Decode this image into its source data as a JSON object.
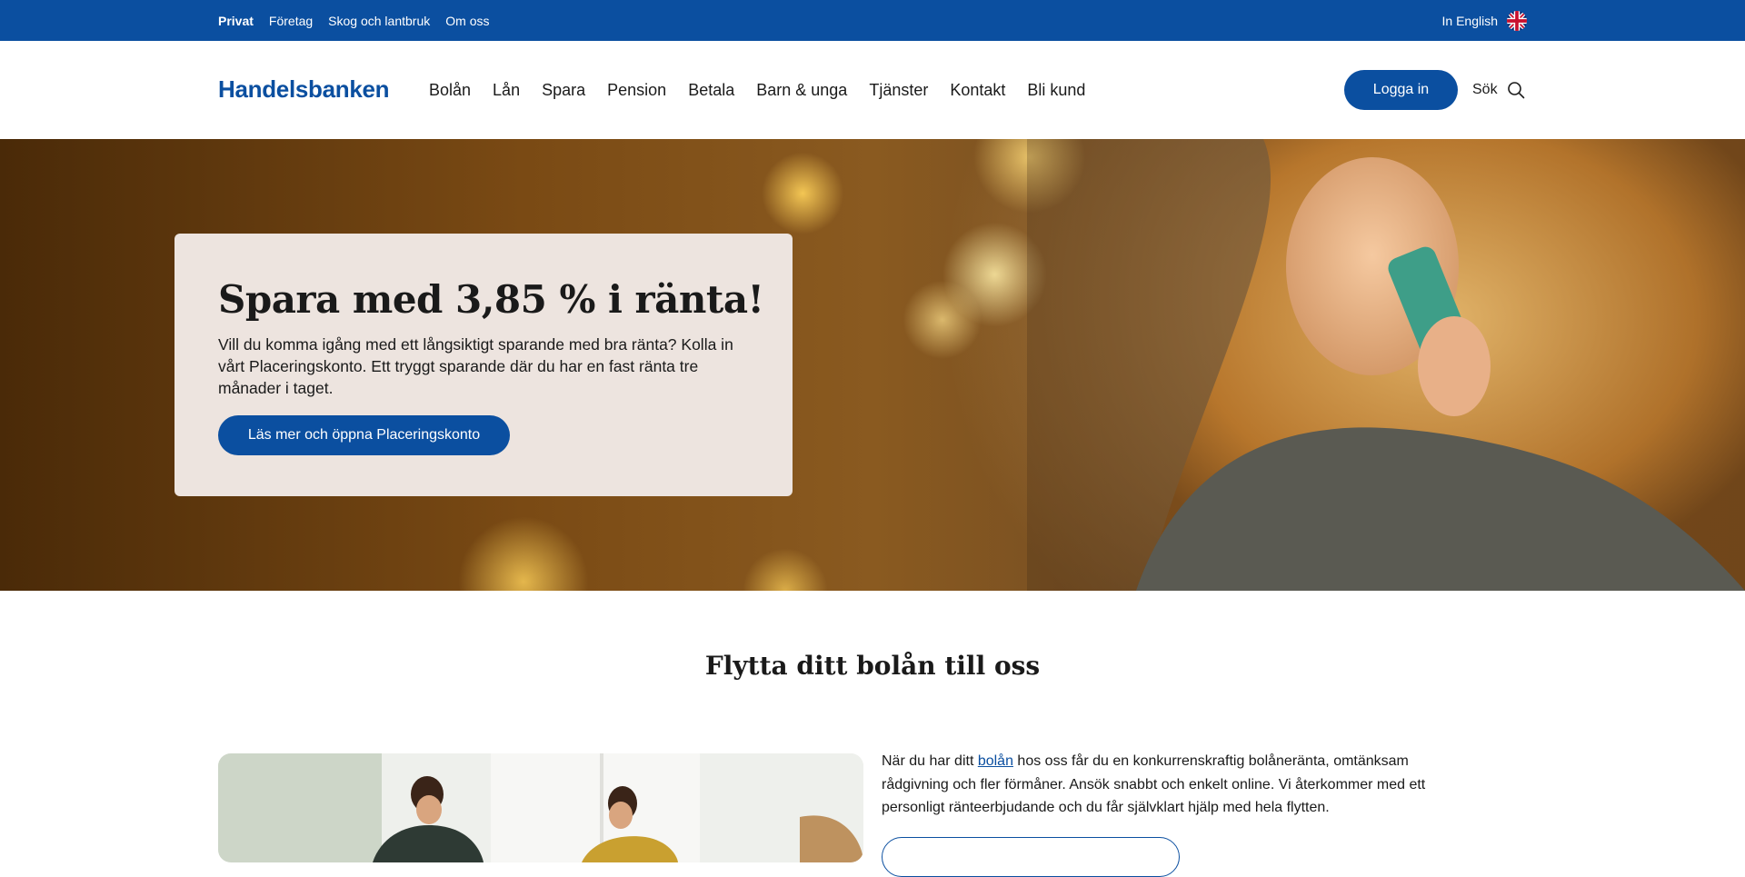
{
  "topbar": {
    "segments": [
      "Privat",
      "Företag",
      "Skog och lantbruk",
      "Om oss"
    ],
    "active_segment": "Privat",
    "language_label": "In English"
  },
  "header": {
    "logo_text": "Handelsbanken",
    "nav": [
      "Bolån",
      "Lån",
      "Spara",
      "Pension",
      "Betala",
      "Barn & unga",
      "Tjänster",
      "Kontakt",
      "Bli kund"
    ],
    "login_label": "Logga in",
    "search_label": "Sök"
  },
  "hero": {
    "title": "Spara med 3,85 % i ränta!",
    "body": "Vill du komma igång med ett långsiktigt sparande med bra ränta? Kolla in vårt Placeringskonto. Ett tryggt sparande där du har en fast ränta tre månader i taget.",
    "cta_label": "Läs mer och öppna Placeringskonto"
  },
  "section": {
    "title": "Flytta ditt bolån till oss",
    "text_before_link": "När du har ditt ",
    "link_text": "bolån",
    "text_after_link": " hos oss får du en konkurrenskraftig bolåneränta, omtänksam rådgivning och fler förmåner. Ansök snabbt och enkelt online. Vi återkommer med ett personligt ränteerbjudande och du får självklart hjälp med hela flytten."
  },
  "colors": {
    "brand_blue": "#0b4fa0",
    "hero_card_bg": "#ede4df"
  }
}
